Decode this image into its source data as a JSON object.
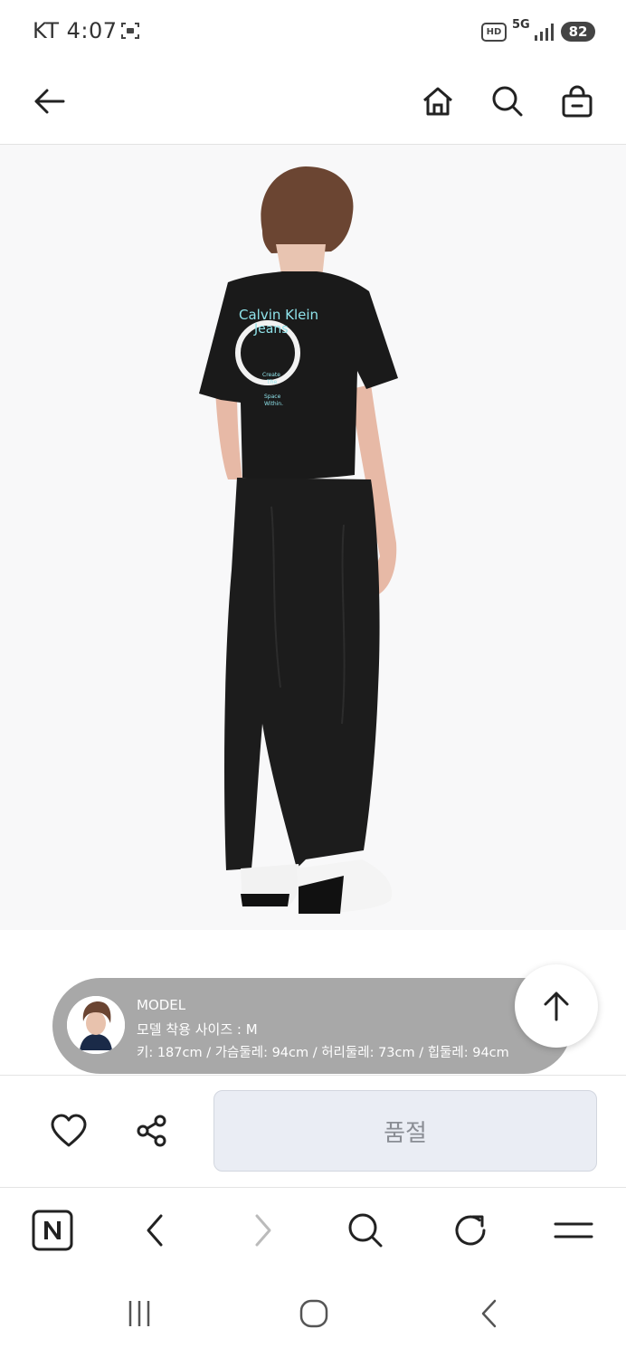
{
  "status_bar": {
    "time": "KT 4:07",
    "hd_badge": "HD",
    "network": "5G",
    "battery": "82"
  },
  "header": {
    "icons": [
      "back-arrow-icon",
      "home-icon",
      "search-icon",
      "shopping-bag-icon"
    ]
  },
  "product": {
    "image_subject": "model-back-view",
    "print_text": [
      "Calvin Klein",
      "Jeans",
      "Create",
      "The",
      "Space",
      "Within."
    ]
  },
  "model_info": {
    "title": "MODEL",
    "size_line": "모델 착용 사이즈 : M",
    "measurements": "키: 187cm  /  가슴둘레: 94cm  /  허리둘레: 73cm  /  힙둘레: 94cm"
  },
  "actions": {
    "sold_out_label": "품절"
  },
  "browser_toolbar": {
    "icons": [
      "naver-n-icon",
      "back-chevron-icon",
      "forward-chevron-icon",
      "search-icon",
      "refresh-icon",
      "menu-icon"
    ]
  },
  "colors": {
    "accent_text": "#222222",
    "pill_bg": "#a8a8a8",
    "sold_out_bg": "#eaedf4",
    "shirt_print": "#8fe3ea"
  }
}
